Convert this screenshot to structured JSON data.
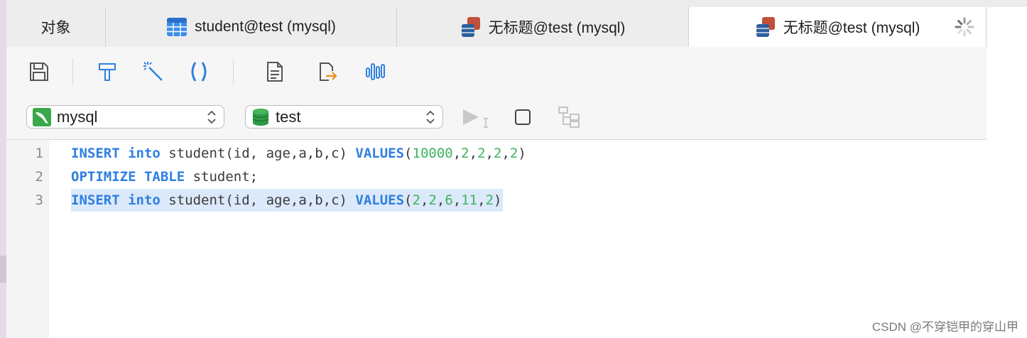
{
  "tabs": [
    {
      "label": "对象",
      "icon": "none"
    },
    {
      "label": "student@test (mysql)",
      "icon": "table-icon"
    },
    {
      "label": "无标题@test (mysql)",
      "icon": "query-icon"
    },
    {
      "label": "无标题@test (mysql)",
      "icon": "query-icon",
      "active": true
    }
  ],
  "toolbar": {
    "icons": [
      "save-icon",
      "format-icon",
      "magic-wand-icon",
      "parentheses-icon",
      "document-icon",
      "export-icon",
      "explain-icon"
    ]
  },
  "connection": {
    "selected": "mysql",
    "icon": "mysql-dolphin-icon"
  },
  "database": {
    "selected": "test",
    "icon": "database-icon"
  },
  "editor": {
    "lines": [
      {
        "num": "1",
        "parts": [
          {
            "t": "INSERT",
            "c": "kw"
          },
          {
            "t": " ",
            "c": ""
          },
          {
            "t": "into",
            "c": "kw"
          },
          {
            "t": " student(id, age,a,b,c) ",
            "c": ""
          },
          {
            "t": "VALUES",
            "c": "kw"
          },
          {
            "t": "(",
            "c": ""
          },
          {
            "t": "10000",
            "c": "num"
          },
          {
            "t": ",",
            "c": ""
          },
          {
            "t": "2",
            "c": "num"
          },
          {
            "t": ",",
            "c": ""
          },
          {
            "t": "2",
            "c": "num"
          },
          {
            "t": ",",
            "c": ""
          },
          {
            "t": "2",
            "c": "num"
          },
          {
            "t": ",",
            "c": ""
          },
          {
            "t": "2",
            "c": "num"
          },
          {
            "t": ")",
            "c": ""
          }
        ]
      },
      {
        "num": "2",
        "parts": [
          {
            "t": "OPTIMIZE",
            "c": "kw"
          },
          {
            "t": " ",
            "c": ""
          },
          {
            "t": "TABLE",
            "c": "kw"
          },
          {
            "t": " student;",
            "c": ""
          }
        ]
      },
      {
        "num": "3",
        "highlight": true,
        "parts": [
          {
            "t": "INSERT",
            "c": "kw"
          },
          {
            "t": " ",
            "c": ""
          },
          {
            "t": "into",
            "c": "kw"
          },
          {
            "t": " student(id, age,a,b,c) ",
            "c": ""
          },
          {
            "t": "VALUES",
            "c": "kw"
          },
          {
            "t": "(",
            "c": ""
          },
          {
            "t": "2",
            "c": "num"
          },
          {
            "t": ",",
            "c": ""
          },
          {
            "t": "2",
            "c": "num"
          },
          {
            "t": ",",
            "c": ""
          },
          {
            "t": "6",
            "c": "num"
          },
          {
            "t": ",",
            "c": ""
          },
          {
            "t": "11",
            "c": "num"
          },
          {
            "t": ",",
            "c": ""
          },
          {
            "t": "2",
            "c": "num"
          },
          {
            "t": ")",
            "c": ""
          }
        ]
      }
    ]
  },
  "watermark": "CSDN @不穿铠甲的穿山甲",
  "colors": {
    "keyword": "#2f7fe0",
    "number": "#3fb35f",
    "highlight": "#dbe9fa",
    "mysql_green": "#3aa84a",
    "db_green": "#2e9a45"
  }
}
